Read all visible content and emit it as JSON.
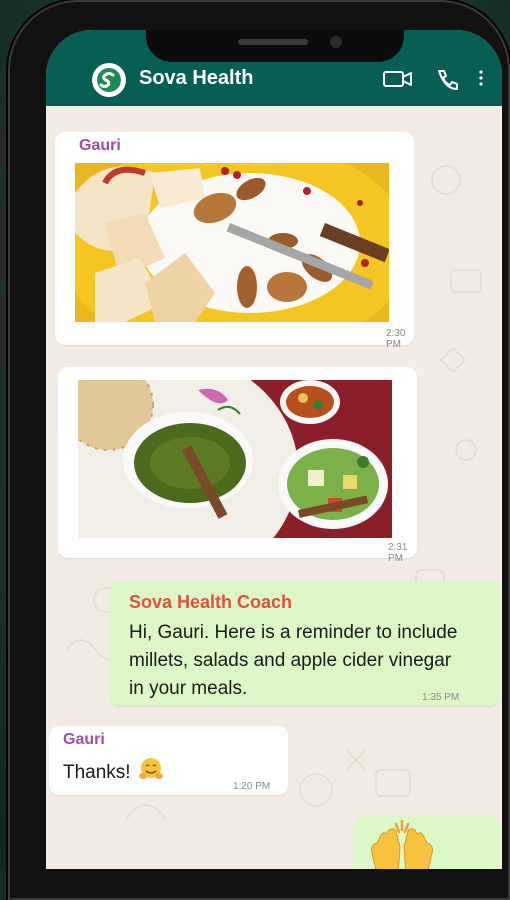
{
  "header": {
    "title": "Sova Health",
    "icons": [
      "sova-logo-icon",
      "video-call-icon",
      "phone-call-icon",
      "more-options-icon"
    ],
    "color": "#075e54"
  },
  "messages": [
    {
      "sender": "Gauri",
      "type": "image",
      "image": "fruit-yogurt-bowl",
      "time": "2:30 PM"
    },
    {
      "type": "image",
      "image": "millet-meal-with-salad",
      "time": "2:31 PM"
    },
    {
      "sender": "Sova Health Coach",
      "type": "text",
      "text": "Hi, Gauri. Here is a reminder to include millets, salads and apple cider vinegar in your meals.",
      "lines": [
        "Hi, Gauri. Here is a reminder to include",
        "millets, salads and apple cider vinegar",
        "in your meals."
      ],
      "time": "1:35 PM"
    },
    {
      "sender": "Gauri",
      "type": "text",
      "text": "Thanks!",
      "emoji": "hugging-face",
      "time": "1:20 PM"
    },
    {
      "type": "emoji",
      "emoji": "raising-hands"
    }
  ],
  "colors": {
    "incoming_bubble": "#ffffff",
    "outgoing_bubble": "#dcf8c6",
    "sender_name": "#9b4fa6",
    "coach_name": "#e0523d",
    "chat_background": "#f3ece4"
  }
}
